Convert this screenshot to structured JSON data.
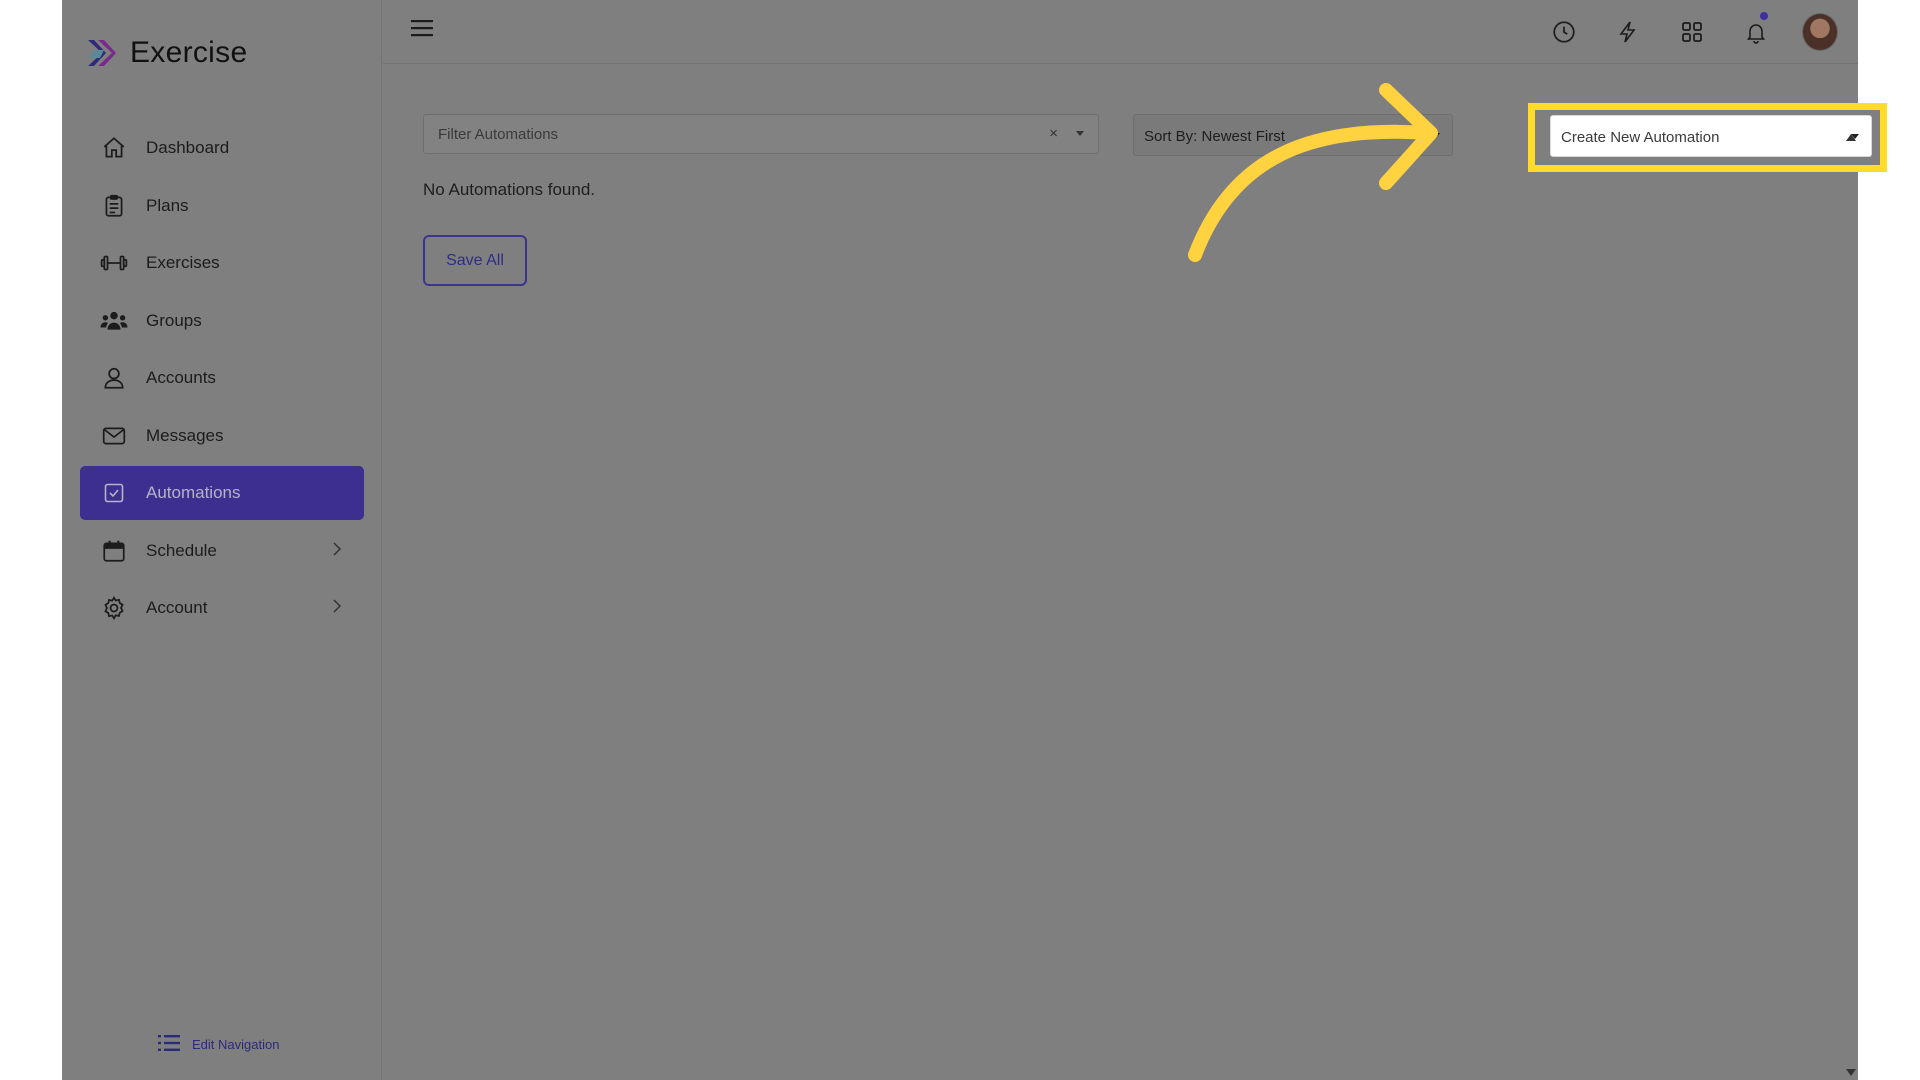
{
  "app": {
    "title": "Exercise"
  },
  "sidebar": {
    "items": [
      {
        "label": "Dashboard",
        "icon": "home-icon"
      },
      {
        "label": "Plans",
        "icon": "clipboard-icon"
      },
      {
        "label": "Exercises",
        "icon": "dumbbell-icon"
      },
      {
        "label": "Groups",
        "icon": "users-icon"
      },
      {
        "label": "Accounts",
        "icon": "user-icon"
      },
      {
        "label": "Messages",
        "icon": "envelope-icon"
      },
      {
        "label": "Automations",
        "icon": "checkbox-icon",
        "active": true
      },
      {
        "label": "Schedule",
        "icon": "calendar-icon",
        "has_submenu": true
      },
      {
        "label": "Account",
        "icon": "gear-icon",
        "has_submenu": true
      }
    ],
    "edit_navigation": "Edit Navigation"
  },
  "topbar": {
    "icons": [
      "history-icon",
      "bolt-icon",
      "apps-grid-icon",
      "bell-icon",
      "avatar"
    ]
  },
  "main": {
    "filter": {
      "placeholder": "Filter Automations"
    },
    "sort": {
      "value": "Sort By: Newest First"
    },
    "create": {
      "value": "Create New Automation"
    },
    "empty_message": "No Automations found.",
    "save_all": "Save All"
  },
  "colors": {
    "accent": "#3d2f8f",
    "highlight": "#ffdb2a",
    "overlay_gray": "#7f7f7f"
  }
}
